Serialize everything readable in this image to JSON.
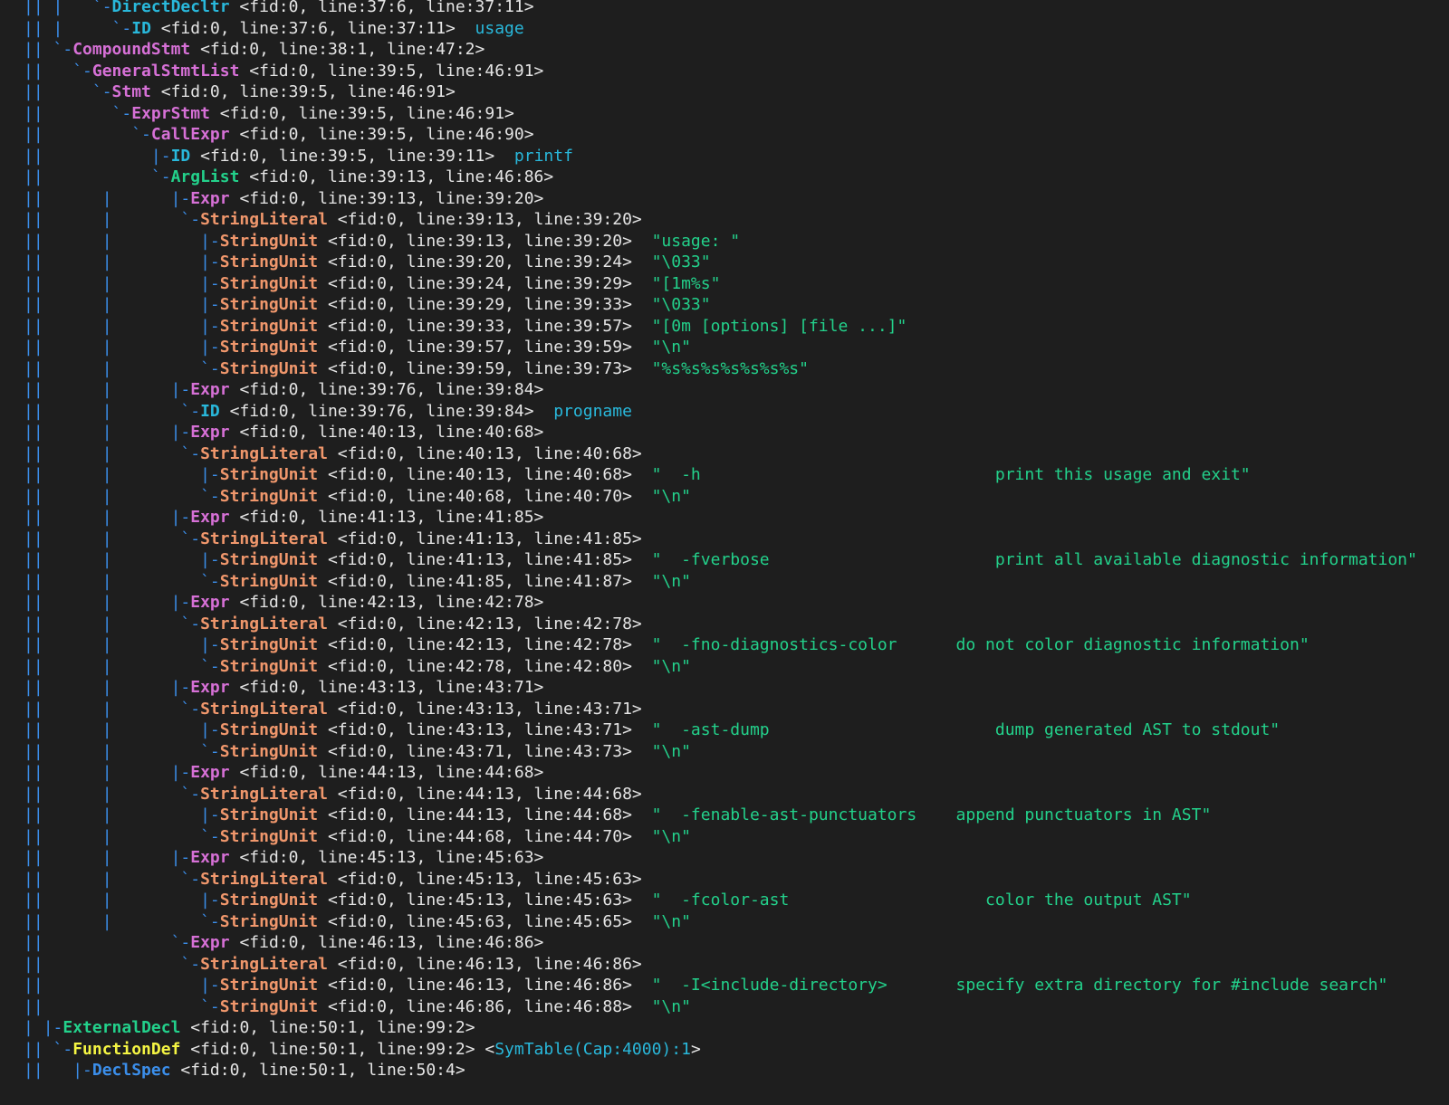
{
  "colors": {
    "background": "#1e1e1e",
    "tree_branch": "#3b8eea",
    "location": "#e5e5e5",
    "id_value": "#29b8db",
    "string_value": "#23d18b",
    "node_cyan": "#29b8db",
    "node_magenta": "#d670d6",
    "node_green": "#23d18b",
    "node_yellow": "#f5f543",
    "node_orange": "#f0976c",
    "node_blue": "#3b8eea"
  },
  "lines": [
    {
      "g": [
        1,
        3
      ],
      "pre": "      ",
      "br": "`-",
      "name": "DirectDecltr",
      "nc": "#29b8db",
      "loc": " <fid:0, line:37:6, line:37:11>",
      "val": ""
    },
    {
      "g": [
        1,
        3
      ],
      "pre": "        ",
      "br": "`-",
      "name": "ID",
      "nc": "#29b8db",
      "loc": " <fid:0, line:37:6, line:37:11>",
      "val": "  usage",
      "vc": "#29b8db"
    },
    {
      "g": [
        1
      ],
      "pre": "  ",
      "br": "`-",
      "name": "CompoundStmt",
      "nc": "#d670d6",
      "loc": " <fid:0, line:38:1, line:47:2>",
      "val": ""
    },
    {
      "g": [
        1
      ],
      "pre": "    ",
      "br": "`-",
      "name": "GeneralStmtList",
      "nc": "#d670d6",
      "loc": " <fid:0, line:39:5, line:46:91>",
      "val": ""
    },
    {
      "g": [
        1
      ],
      "pre": "      ",
      "br": "`-",
      "name": "Stmt",
      "nc": "#d670d6",
      "loc": " <fid:0, line:39:5, line:46:91>",
      "val": ""
    },
    {
      "g": [
        1
      ],
      "pre": "        ",
      "br": "`-",
      "name": "ExprStmt",
      "nc": "#d670d6",
      "loc": " <fid:0, line:39:5, line:46:91>",
      "val": ""
    },
    {
      "g": [
        1
      ],
      "pre": "          ",
      "br": "`-",
      "name": "CallExpr",
      "nc": "#d670d6",
      "loc": " <fid:0, line:39:5, line:46:90>",
      "val": ""
    },
    {
      "g": [
        1
      ],
      "pre": "            ",
      "br": "|-",
      "name": "ID",
      "nc": "#29b8db",
      "loc": " <fid:0, line:39:5, line:39:11>",
      "val": "  printf",
      "vc": "#29b8db"
    },
    {
      "g": [
        1
      ],
      "pre": "            ",
      "br": "`-",
      "name": "ArgList",
      "nc": "#23d18b",
      "loc": " <fid:0, line:39:13, line:46:86>",
      "val": ""
    },
    {
      "g": [
        1,
        8
      ],
      "pre": "              ",
      "br": "|-",
      "name": "Expr",
      "nc": "#d670d6",
      "loc": " <fid:0, line:39:13, line:39:20>",
      "val": ""
    },
    {
      "g": [
        1,
        8
      ],
      "pre": "              ",
      "br": " `-",
      "name": "StringLiteral",
      "nc": "#f0976c",
      "loc": " <fid:0, line:39:13, line:39:20>",
      "val": ""
    },
    {
      "g": [
        1,
        8
      ],
      "pre": "              ",
      "br": "   |-",
      "name": "StringUnit",
      "nc": "#f0976c",
      "loc": " <fid:0, line:39:13, line:39:20>",
      "val": "  \"usage: \"",
      "vc": "#23d18b"
    },
    {
      "g": [
        1,
        8
      ],
      "pre": "              ",
      "br": "   |-",
      "name": "StringUnit",
      "nc": "#f0976c",
      "loc": " <fid:0, line:39:20, line:39:24>",
      "val": "  \"\\033\"",
      "vc": "#23d18b"
    },
    {
      "g": [
        1,
        8
      ],
      "pre": "              ",
      "br": "   |-",
      "name": "StringUnit",
      "nc": "#f0976c",
      "loc": " <fid:0, line:39:24, line:39:29>",
      "val": "  \"[1m%s\"",
      "vc": "#23d18b"
    },
    {
      "g": [
        1,
        8
      ],
      "pre": "              ",
      "br": "   |-",
      "name": "StringUnit",
      "nc": "#f0976c",
      "loc": " <fid:0, line:39:29, line:39:33>",
      "val": "  \"\\033\"",
      "vc": "#23d18b"
    },
    {
      "g": [
        1,
        8
      ],
      "pre": "              ",
      "br": "   |-",
      "name": "StringUnit",
      "nc": "#f0976c",
      "loc": " <fid:0, line:39:33, line:39:57>",
      "val": "  \"[0m [options] [file ...]\"",
      "vc": "#23d18b"
    },
    {
      "g": [
        1,
        8
      ],
      "pre": "              ",
      "br": "   |-",
      "name": "StringUnit",
      "nc": "#f0976c",
      "loc": " <fid:0, line:39:57, line:39:59>",
      "val": "  \"\\n\"",
      "vc": "#23d18b"
    },
    {
      "g": [
        1,
        8
      ],
      "pre": "              ",
      "br": "   `-",
      "name": "StringUnit",
      "nc": "#f0976c",
      "loc": " <fid:0, line:39:59, line:39:73>",
      "val": "  \"%s%s%s%s%s%s%s\"",
      "vc": "#23d18b"
    },
    {
      "g": [
        1,
        8
      ],
      "pre": "              ",
      "br": "|-",
      "name": "Expr",
      "nc": "#d670d6",
      "loc": " <fid:0, line:39:76, line:39:84>",
      "val": ""
    },
    {
      "g": [
        1,
        8
      ],
      "pre": "              ",
      "br": " `-",
      "name": "ID",
      "nc": "#29b8db",
      "loc": " <fid:0, line:39:76, line:39:84>",
      "val": "  progname",
      "vc": "#29b8db"
    },
    {
      "g": [
        1,
        8
      ],
      "pre": "              ",
      "br": "|-",
      "name": "Expr",
      "nc": "#d670d6",
      "loc": " <fid:0, line:40:13, line:40:68>",
      "val": ""
    },
    {
      "g": [
        1,
        8
      ],
      "pre": "              ",
      "br": " `-",
      "name": "StringLiteral",
      "nc": "#f0976c",
      "loc": " <fid:0, line:40:13, line:40:68>",
      "val": ""
    },
    {
      "g": [
        1,
        8
      ],
      "pre": "              ",
      "br": "   |-",
      "name": "StringUnit",
      "nc": "#f0976c",
      "loc": " <fid:0, line:40:13, line:40:68>",
      "val": "  \"  -h                              print this usage and exit\"",
      "vc": "#23d18b"
    },
    {
      "g": [
        1,
        8
      ],
      "pre": "              ",
      "br": "   `-",
      "name": "StringUnit",
      "nc": "#f0976c",
      "loc": " <fid:0, line:40:68, line:40:70>",
      "val": "  \"\\n\"",
      "vc": "#23d18b"
    },
    {
      "g": [
        1,
        8
      ],
      "pre": "              ",
      "br": "|-",
      "name": "Expr",
      "nc": "#d670d6",
      "loc": " <fid:0, line:41:13, line:41:85>",
      "val": ""
    },
    {
      "g": [
        1,
        8
      ],
      "pre": "              ",
      "br": " `-",
      "name": "StringLiteral",
      "nc": "#f0976c",
      "loc": " <fid:0, line:41:13, line:41:85>",
      "val": ""
    },
    {
      "g": [
        1,
        8
      ],
      "pre": "              ",
      "br": "   |-",
      "name": "StringUnit",
      "nc": "#f0976c",
      "loc": " <fid:0, line:41:13, line:41:85>",
      "val": "  \"  -fverbose                       print all available diagnostic information\"",
      "vc": "#23d18b"
    },
    {
      "g": [
        1,
        8
      ],
      "pre": "              ",
      "br": "   `-",
      "name": "StringUnit",
      "nc": "#f0976c",
      "loc": " <fid:0, line:41:85, line:41:87>",
      "val": "  \"\\n\"",
      "vc": "#23d18b"
    },
    {
      "g": [
        1,
        8
      ],
      "pre": "              ",
      "br": "|-",
      "name": "Expr",
      "nc": "#d670d6",
      "loc": " <fid:0, line:42:13, line:42:78>",
      "val": ""
    },
    {
      "g": [
        1,
        8
      ],
      "pre": "              ",
      "br": " `-",
      "name": "StringLiteral",
      "nc": "#f0976c",
      "loc": " <fid:0, line:42:13, line:42:78>",
      "val": ""
    },
    {
      "g": [
        1,
        8
      ],
      "pre": "              ",
      "br": "   |-",
      "name": "StringUnit",
      "nc": "#f0976c",
      "loc": " <fid:0, line:42:13, line:42:78>",
      "val": "  \"  -fno-diagnostics-color      do not color diagnostic information\"",
      "vc": "#23d18b"
    },
    {
      "g": [
        1,
        8
      ],
      "pre": "              ",
      "br": "   `-",
      "name": "StringUnit",
      "nc": "#f0976c",
      "loc": " <fid:0, line:42:78, line:42:80>",
      "val": "  \"\\n\"",
      "vc": "#23d18b"
    },
    {
      "g": [
        1,
        8
      ],
      "pre": "              ",
      "br": "|-",
      "name": "Expr",
      "nc": "#d670d6",
      "loc": " <fid:0, line:43:13, line:43:71>",
      "val": ""
    },
    {
      "g": [
        1,
        8
      ],
      "pre": "              ",
      "br": " `-",
      "name": "StringLiteral",
      "nc": "#f0976c",
      "loc": " <fid:0, line:43:13, line:43:71>",
      "val": ""
    },
    {
      "g": [
        1,
        8
      ],
      "pre": "              ",
      "br": "   |-",
      "name": "StringUnit",
      "nc": "#f0976c",
      "loc": " <fid:0, line:43:13, line:43:71>",
      "val": "  \"  -ast-dump                       dump generated AST to stdout\"",
      "vc": "#23d18b"
    },
    {
      "g": [
        1,
        8
      ],
      "pre": "              ",
      "br": "   `-",
      "name": "StringUnit",
      "nc": "#f0976c",
      "loc": " <fid:0, line:43:71, line:43:73>",
      "val": "  \"\\n\"",
      "vc": "#23d18b"
    },
    {
      "g": [
        1,
        8
      ],
      "pre": "              ",
      "br": "|-",
      "name": "Expr",
      "nc": "#d670d6",
      "loc": " <fid:0, line:44:13, line:44:68>",
      "val": ""
    },
    {
      "g": [
        1,
        8
      ],
      "pre": "              ",
      "br": " `-",
      "name": "StringLiteral",
      "nc": "#f0976c",
      "loc": " <fid:0, line:44:13, line:44:68>",
      "val": ""
    },
    {
      "g": [
        1,
        8
      ],
      "pre": "              ",
      "br": "   |-",
      "name": "StringUnit",
      "nc": "#f0976c",
      "loc": " <fid:0, line:44:13, line:44:68>",
      "val": "  \"  -fenable-ast-punctuators    append punctuators in AST\"",
      "vc": "#23d18b"
    },
    {
      "g": [
        1,
        8
      ],
      "pre": "              ",
      "br": "   `-",
      "name": "StringUnit",
      "nc": "#f0976c",
      "loc": " <fid:0, line:44:68, line:44:70>",
      "val": "  \"\\n\"",
      "vc": "#23d18b"
    },
    {
      "g": [
        1,
        8
      ],
      "pre": "              ",
      "br": "|-",
      "name": "Expr",
      "nc": "#d670d6",
      "loc": " <fid:0, line:45:13, line:45:63>",
      "val": ""
    },
    {
      "g": [
        1,
        8
      ],
      "pre": "              ",
      "br": " `-",
      "name": "StringLiteral",
      "nc": "#f0976c",
      "loc": " <fid:0, line:45:13, line:45:63>",
      "val": ""
    },
    {
      "g": [
        1,
        8
      ],
      "pre": "              ",
      "br": "   |-",
      "name": "StringUnit",
      "nc": "#f0976c",
      "loc": " <fid:0, line:45:13, line:45:63>",
      "val": "  \"  -fcolor-ast                    color the output AST\"",
      "vc": "#23d18b"
    },
    {
      "g": [
        1,
        8
      ],
      "pre": "              ",
      "br": "   `-",
      "name": "StringUnit",
      "nc": "#f0976c",
      "loc": " <fid:0, line:45:63, line:45:65>",
      "val": "  \"\\n\"",
      "vc": "#23d18b"
    },
    {
      "g": [
        1
      ],
      "pre": "              ",
      "br": "`-",
      "name": "Expr",
      "nc": "#d670d6",
      "loc": " <fid:0, line:46:13, line:46:86>",
      "val": ""
    },
    {
      "g": [
        1
      ],
      "pre": "              ",
      "br": " `-",
      "name": "StringLiteral",
      "nc": "#f0976c",
      "loc": " <fid:0, line:46:13, line:46:86>",
      "val": ""
    },
    {
      "g": [
        1
      ],
      "pre": "              ",
      "br": "   |-",
      "name": "StringUnit",
      "nc": "#f0976c",
      "loc": " <fid:0, line:46:13, line:46:86>",
      "val": "  \"  -I<include-directory>       specify extra directory for #include search\"",
      "vc": "#23d18b"
    },
    {
      "g": [
        1
      ],
      "pre": "              ",
      "br": "   `-",
      "name": "StringUnit",
      "nc": "#f0976c",
      "loc": " <fid:0, line:46:86, line:46:88>",
      "val": "  \"\\n\"",
      "vc": "#23d18b"
    },
    {
      "g": [],
      "pre": " ",
      "br": "|-",
      "name": "ExternalDecl",
      "nc": "#23d18b",
      "loc": " <fid:0, line:50:1, line:99:2>",
      "val": ""
    },
    {
      "g": [
        1
      ],
      "pre": "  ",
      "br": "`-",
      "name": "FunctionDef",
      "nc": "#f5f543",
      "loc": " <fid:0, line:50:1, line:99:2> <",
      "val": "SymTable(Cap:4000):1",
      "vc": "#29b8db",
      "tail": ">"
    },
    {
      "g": [
        1
      ],
      "pre": "    ",
      "br": "|-",
      "name": "DeclSpec",
      "nc": "#3b8eea",
      "loc": " <fid:0, line:50:1, line:50:4>",
      "val": ""
    }
  ]
}
